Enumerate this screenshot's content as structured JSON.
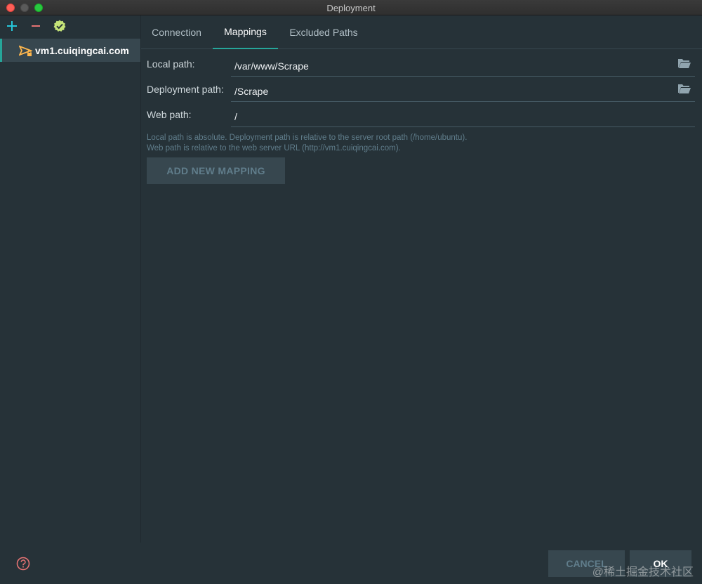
{
  "window": {
    "title": "Deployment"
  },
  "sidebar": {
    "add_icon": "plus-icon",
    "remove_icon": "minus-icon",
    "default_icon": "check-badge-icon",
    "servers": [
      {
        "label": "vm1.cuiqingcai.com",
        "icon": "sftp-server-icon"
      }
    ]
  },
  "tabs": [
    {
      "label": "Connection",
      "active": false
    },
    {
      "label": "Mappings",
      "active": true
    },
    {
      "label": "Excluded Paths",
      "active": false
    }
  ],
  "mappings": {
    "local_path": {
      "label": "Local path:",
      "value": "/var/www/Scrape"
    },
    "deployment_path": {
      "label": "Deployment path:",
      "value": "/Scrape"
    },
    "web_path": {
      "label": "Web path:",
      "value": "/"
    },
    "hint_line1": "Local path is absolute. Deployment path is relative to the server root path (/home/ubuntu).",
    "hint_line2": "Web path is relative to the web server URL (http://vm1.cuiqingcai.com).",
    "add_button": "ADD NEW MAPPING"
  },
  "footer": {
    "cancel": "CANCEL",
    "ok": "OK",
    "help_icon": "question-icon",
    "watermark": "@稀土掘金技术社区"
  },
  "colors": {
    "background": "#263238",
    "accent": "#26a69a",
    "panel": "#37474f"
  }
}
